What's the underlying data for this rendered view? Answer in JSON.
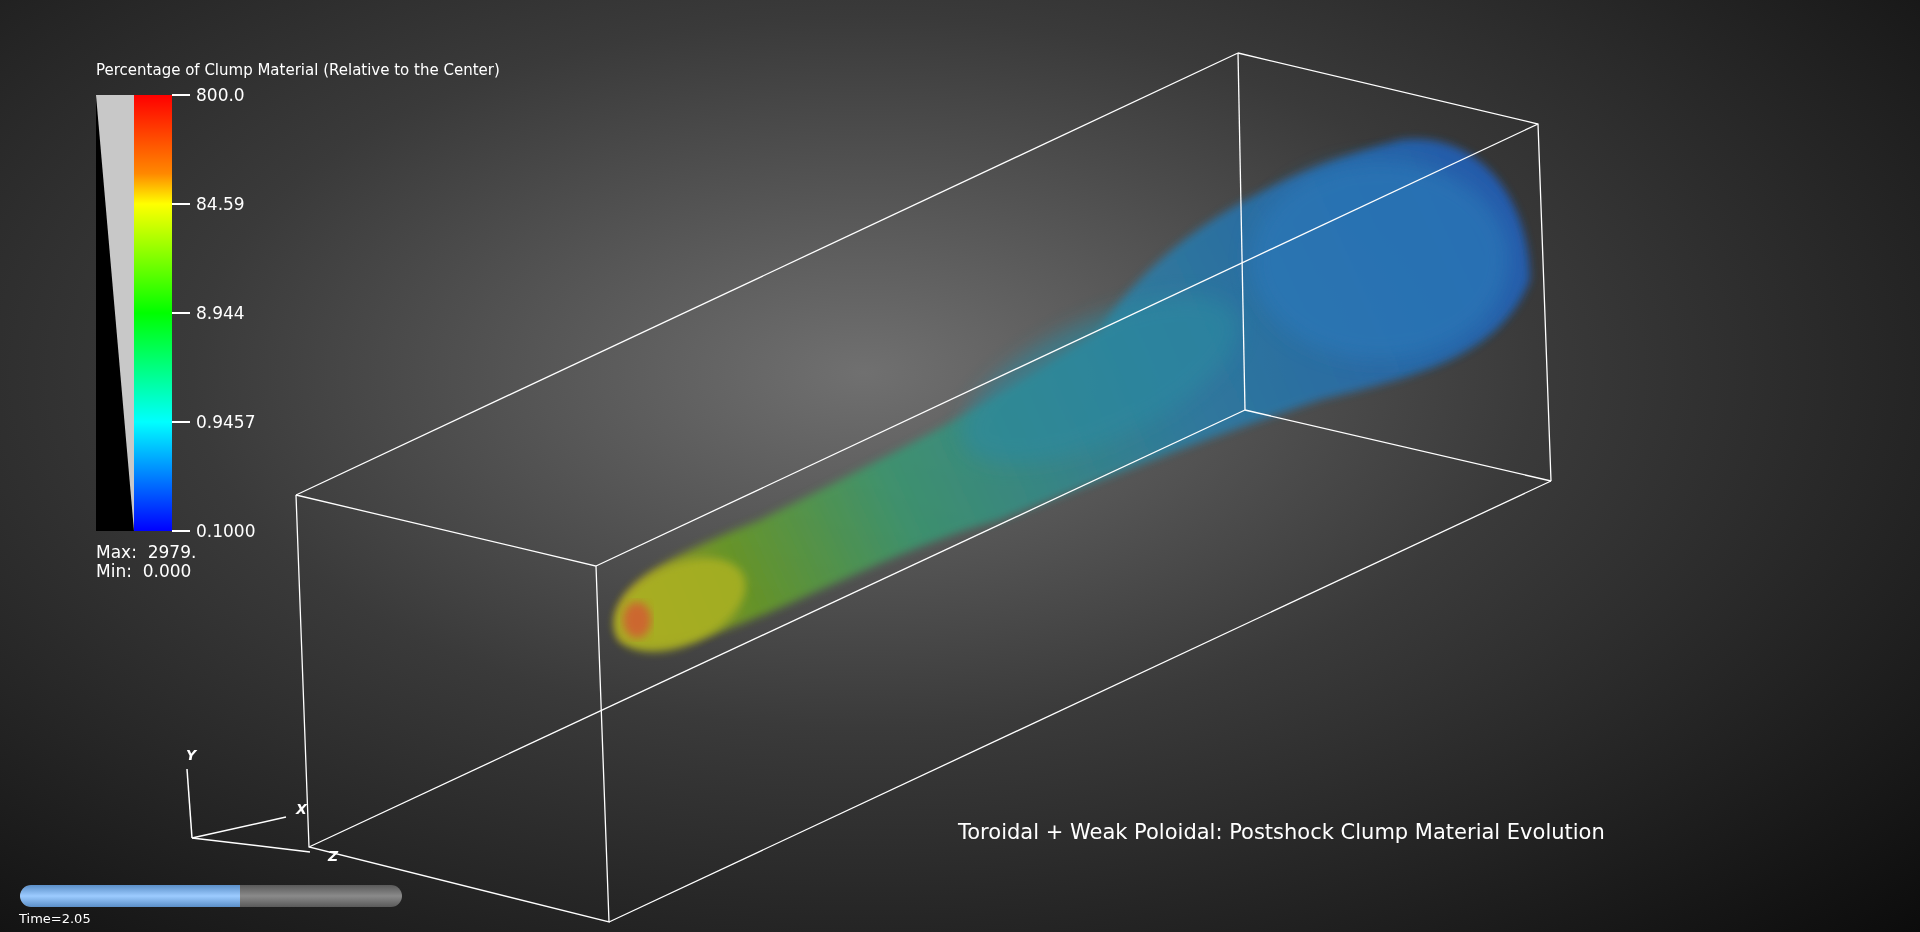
{
  "legend": {
    "title": "Percentage of Clump Material (Relative to the Center)",
    "ticks": [
      "800.0",
      "84.59",
      "8.944",
      "0.9457",
      "0.1000"
    ],
    "max": "Max:  2979.",
    "min": "Min:  0.000"
  },
  "axes_triad": {
    "y": "Y",
    "x": "X",
    "z": "Z"
  },
  "time_slider": {
    "level": 0.576,
    "label": "Time=2.05"
  },
  "plot_title": "Toroidal + Weak Poloidal: Postshock Clump Material Evolution"
}
